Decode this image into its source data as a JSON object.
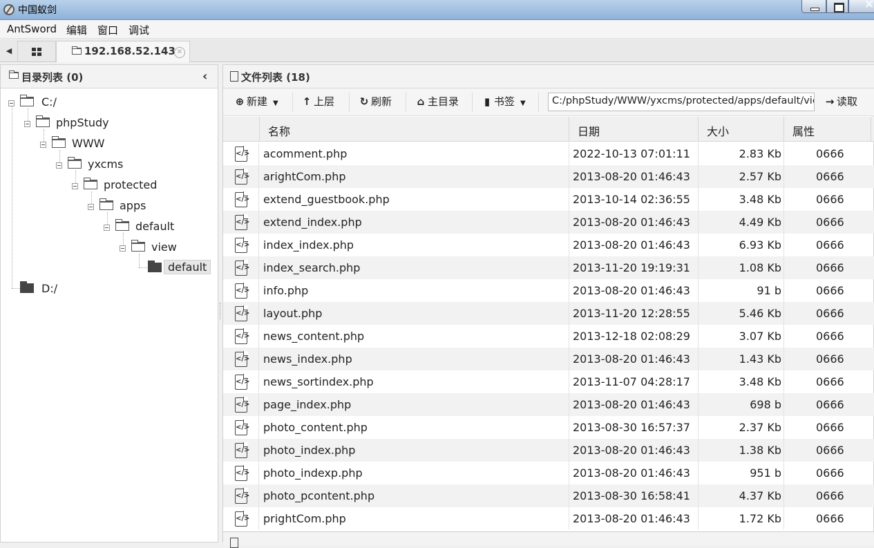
{
  "window": {
    "title": "中国蚁剑"
  },
  "menu": [
    "AntSword",
    "编辑",
    "窗口",
    "调试"
  ],
  "tabs": {
    "host": "192.168.52.143"
  },
  "left_panel": {
    "title": "目录列表 (0)",
    "tree": [
      {
        "label": "C:/",
        "level": 0
      },
      {
        "label": "phpStudy",
        "level": 1
      },
      {
        "label": "WWW",
        "level": 2
      },
      {
        "label": "yxcms",
        "level": 3
      },
      {
        "label": "protected",
        "level": 4
      },
      {
        "label": "apps",
        "level": 5
      },
      {
        "label": "default",
        "level": 6
      },
      {
        "label": "view",
        "level": 7
      },
      {
        "label": "default",
        "level": 8,
        "selected": true
      },
      {
        "label": "D:/",
        "level": 0
      }
    ]
  },
  "right_panel": {
    "title": "文件列表 (18)",
    "toolbar": {
      "new": "新建",
      "up": "上层",
      "refresh": "刷新",
      "home": "主目录",
      "bookmark": "书签",
      "path": "C:/phpStudy/WWW/yxcms/protected/apps/default/view/d",
      "read": "读取"
    },
    "columns": [
      "名称",
      "日期",
      "大小",
      "属性"
    ],
    "files": [
      {
        "name": "acomment.php",
        "date": "2022-10-13 07:01:11",
        "size": "2.83 Kb",
        "attr": "0666"
      },
      {
        "name": "arightCom.php",
        "date": "2013-08-20 01:46:43",
        "size": "2.57 Kb",
        "attr": "0666"
      },
      {
        "name": "extend_guestbook.php",
        "date": "2013-10-14 02:36:55",
        "size": "3.48 Kb",
        "attr": "0666"
      },
      {
        "name": "extend_index.php",
        "date": "2013-08-20 01:46:43",
        "size": "4.49 Kb",
        "attr": "0666"
      },
      {
        "name": "index_index.php",
        "date": "2013-08-20 01:46:43",
        "size": "6.93 Kb",
        "attr": "0666"
      },
      {
        "name": "index_search.php",
        "date": "2013-11-20 19:19:31",
        "size": "1.08 Kb",
        "attr": "0666"
      },
      {
        "name": "info.php",
        "date": "2013-08-20 01:46:43",
        "size": "91 b",
        "attr": "0666"
      },
      {
        "name": "layout.php",
        "date": "2013-11-20 12:28:55",
        "size": "5.46 Kb",
        "attr": "0666"
      },
      {
        "name": "news_content.php",
        "date": "2013-12-18 02:08:29",
        "size": "3.07 Kb",
        "attr": "0666"
      },
      {
        "name": "news_index.php",
        "date": "2013-08-20 01:46:43",
        "size": "1.43 Kb",
        "attr": "0666"
      },
      {
        "name": "news_sortindex.php",
        "date": "2013-11-07 04:28:17",
        "size": "3.48 Kb",
        "attr": "0666"
      },
      {
        "name": "page_index.php",
        "date": "2013-08-20 01:46:43",
        "size": "698 b",
        "attr": "0666"
      },
      {
        "name": "photo_content.php",
        "date": "2013-08-30 16:57:37",
        "size": "2.37 Kb",
        "attr": "0666"
      },
      {
        "name": "photo_index.php",
        "date": "2013-08-20 01:46:43",
        "size": "1.38 Kb",
        "attr": "0666"
      },
      {
        "name": "photo_indexp.php",
        "date": "2013-08-20 01:46:43",
        "size": "951 b",
        "attr": "0666"
      },
      {
        "name": "photo_pcontent.php",
        "date": "2013-08-30 16:58:41",
        "size": "4.37 Kb",
        "attr": "0666"
      },
      {
        "name": "prightCom.php",
        "date": "2013-08-20 01:46:43",
        "size": "1.72 Kb",
        "attr": "0666"
      }
    ]
  },
  "icons": {
    "file": "php-file-icon",
    "folder": "folder-icon"
  }
}
